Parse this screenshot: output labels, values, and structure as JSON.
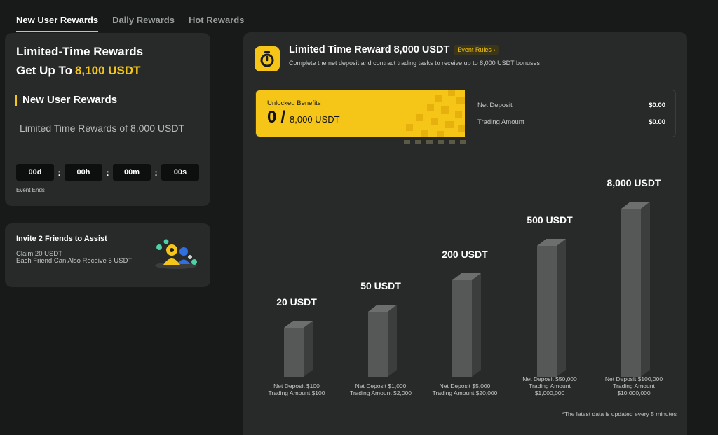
{
  "tabs": [
    {
      "label": "New User Rewards",
      "active": true
    },
    {
      "label": "Daily Rewards",
      "active": false
    },
    {
      "label": "Hot Rewards",
      "active": false
    }
  ],
  "promo": {
    "title": "Limited-Time Rewards",
    "subtitle_prefix": "Get Up To",
    "subtitle_amount": "8,100 USDT",
    "section_title": "New User Rewards",
    "description": "Limited Time Rewards of 8,000 USDT",
    "countdown": {
      "days": "00d",
      "hours": "00h",
      "minutes": "00m",
      "seconds": "00s"
    },
    "countdown_label": "Event Ends"
  },
  "invite": {
    "title": "Invite 2 Friends to Assist",
    "line1": "Claim 20 USDT",
    "line2": "Each Friend Can Also Receive 5 USDT"
  },
  "panel": {
    "title": "Limited Time Reward 8,000 USDT",
    "rules_label": "Event Rules",
    "description": "Complete the net deposit and contract trading tasks to receive up to 8,000 USDT bonuses",
    "unlocked_label": "Unlocked Benefits",
    "unlocked_value": "0",
    "unlocked_separator": "/",
    "unlocked_total": "8,000 USDT",
    "stats": [
      {
        "label": "Net Deposit",
        "value": "$0.00"
      },
      {
        "label": "Trading Amount",
        "value": "$0.00"
      }
    ],
    "footnote": "*The latest data is updated every 5 minutes"
  },
  "tiers": [
    {
      "reward": "20 USDT",
      "reward_value": 20,
      "cond1": "Net Deposit $100",
      "cond2": "Trading Amount $100",
      "cond3": ""
    },
    {
      "reward": "50 USDT",
      "reward_value": 50,
      "cond1": "Net Deposit $1,000",
      "cond2": "Trading Amount $2,000",
      "cond3": ""
    },
    {
      "reward": "200 USDT",
      "reward_value": 200,
      "cond1": "Net Deposit $5,000",
      "cond2": "Trading Amount $20,000",
      "cond3": ""
    },
    {
      "reward": "500 USDT",
      "reward_value": 500,
      "cond1": "Net Deposit $50,000",
      "cond2": "Trading Amount",
      "cond3": "$1,000,000"
    },
    {
      "reward": "8,000 USDT",
      "reward_value": 8000,
      "cond1": "Net Deposit $100,000",
      "cond2": "Trading Amount",
      "cond3": "$10,000,000"
    }
  ],
  "colors": {
    "accent": "#f5c518",
    "panel": "#272a29",
    "background": "#171a19"
  }
}
